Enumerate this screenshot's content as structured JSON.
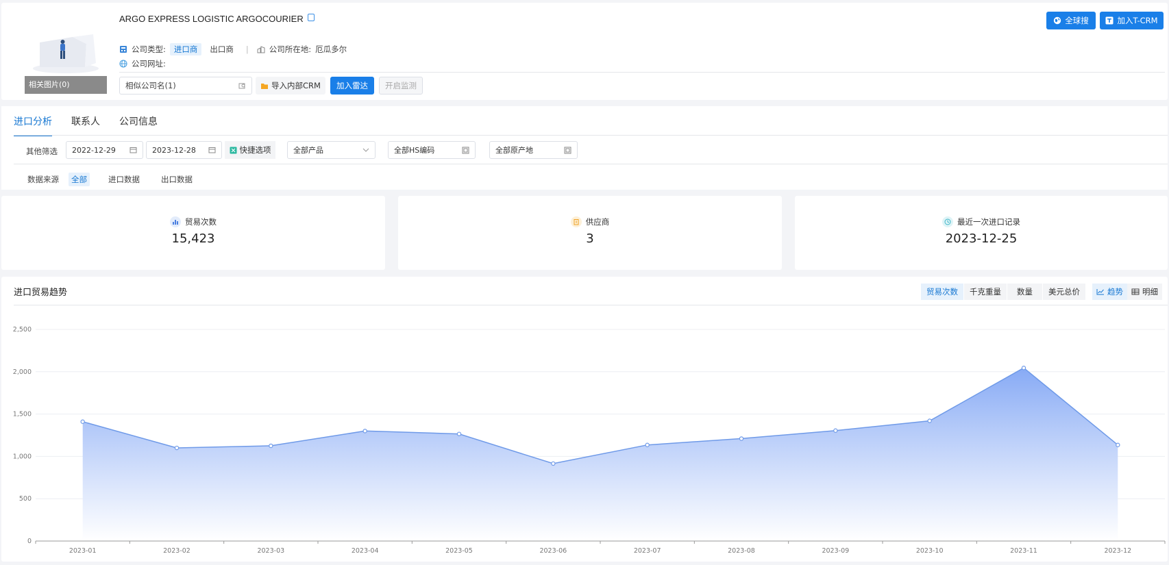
{
  "company": {
    "name": "ARGO EXPRESS LOGISTIC ARGOCOURIER",
    "type_label": "公司类型:",
    "type_import": "进口商",
    "type_export": "出口商",
    "location_label": "公司所在地:",
    "location_value": "厄瓜多尔",
    "website_label": "公司网址:",
    "related_images": "相关图片(0)"
  },
  "actions": {
    "similar_names": "相似公司名(1)",
    "import_crm": "导入内部CRM",
    "add_radar": "加入雷达",
    "start_monitor": "开启监测",
    "global_search": "全球搜",
    "add_tcrm": "加入T-CRM"
  },
  "tabs": [
    {
      "label": "进口分析",
      "active": true
    },
    {
      "label": "联系人",
      "active": false
    },
    {
      "label": "公司信息",
      "active": false
    }
  ],
  "filters": {
    "label": "其他筛选",
    "start_date": "2022-12-29",
    "end_date": "2023-12-28",
    "quick_options": "快捷选项",
    "product": "全部产品",
    "hs_code": "全部HS编码",
    "origin": "全部原产地"
  },
  "source": {
    "label": "数据来源",
    "options": [
      "全部",
      "进口数据",
      "出口数据"
    ],
    "selected": "全部"
  },
  "stats": [
    {
      "label": "贸易次数",
      "value": "15,423",
      "icon": "bar-chart-icon",
      "color": "#4a7fe0"
    },
    {
      "label": "供应商",
      "value": "3",
      "icon": "building-icon",
      "color": "#f0a020"
    },
    {
      "label": "最近一次进口记录",
      "value": "2023-12-25",
      "icon": "clock-icon",
      "color": "#3fb6c8"
    }
  ],
  "trend": {
    "title": "进口贸易趋势",
    "metrics": [
      "贸易次数",
      "千克重量",
      "数量",
      "美元总价"
    ],
    "active_metric": "贸易次数",
    "views": [
      "趋势",
      "明细"
    ],
    "active_view": "趋势"
  },
  "colors": {
    "accent": "#1a7fe8",
    "line": "#6f9ae8",
    "area_top": "#87aaf5"
  },
  "chart_data": {
    "type": "area",
    "x": [
      "2023-01",
      "2023-02",
      "2023-03",
      "2023-04",
      "2023-05",
      "2023-06",
      "2023-07",
      "2023-08",
      "2023-09",
      "2023-10",
      "2023-11",
      "2023-12"
    ],
    "series": [
      {
        "values": [
          1410,
          1100,
          1125,
          1300,
          1265,
          915,
          1135,
          1210,
          1305,
          1420,
          2045,
          1135
        ]
      }
    ],
    "yticks": [
      "0",
      "500",
      "1,000",
      "1,500",
      "2,000",
      "2,500"
    ],
    "ylim": [
      0,
      2500
    ],
    "grid": true
  }
}
